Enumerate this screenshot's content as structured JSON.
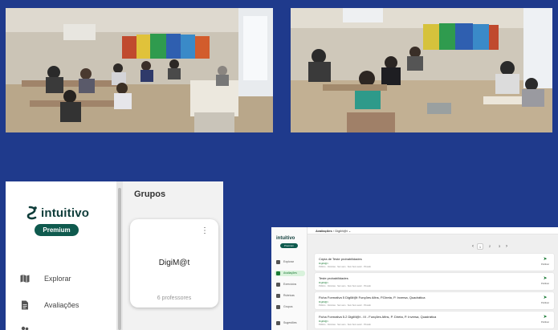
{
  "left_app": {
    "brand": "intuitivo",
    "badge": "Premium",
    "nav": [
      {
        "label": "Explorar",
        "icon": "map-icon"
      },
      {
        "label": "Avaliações",
        "icon": "document-icon"
      }
    ],
    "page_title": "Grupos",
    "group": {
      "name": "DigiM@t",
      "members": "6 professores"
    }
  },
  "right_app": {
    "brand": "intuitivo",
    "badge": "Premium",
    "nav": [
      "Explorar",
      "Avaliações",
      "Exercícios",
      "Rubricas",
      "Grupos",
      "Sugestões"
    ],
    "active_nav": "Avaliações",
    "breadcrumb": [
      "Avaliações",
      "DigiM@t"
    ],
    "pagination": {
      "pages": [
        "1",
        "2",
        "3"
      ],
      "current": "1"
    },
    "publish_label": "Publicar",
    "tests": [
      {
        "title": "Cópia de Teste probabilidades",
        "group": "DigiM@t",
        "meta": "Público · Ciências · Sem ano · Sem Sem autor · Privado"
      },
      {
        "title": "Teste probabilidades",
        "group": "DigiM@t",
        "meta": "Público · Ciências · Sem ano · Sem Sem autor · Privado"
      },
      {
        "title": "Ficha Formativa 5 DigiM@t Funções Afins, P.Direta, P. Inversa, Quadrática",
        "group": "DigiM@t",
        "meta": "Público · Ciências · Sem ano · Sem Sem autor · Privado"
      },
      {
        "title": "Ficha Formativa 5.2 DigiM@t - III - Funções Afins, P. Direta, P. Inversa, Quadrática",
        "group": "DigiM@t",
        "meta": "Público · Ciências · Sem ano · Sem Sem autor · Privado"
      }
    ]
  },
  "colors": {
    "background": "#1f3a8c",
    "brand_dark": "#0f3d3a",
    "badge_green": "#0f5a4e",
    "active_green": "#1b7a35"
  }
}
